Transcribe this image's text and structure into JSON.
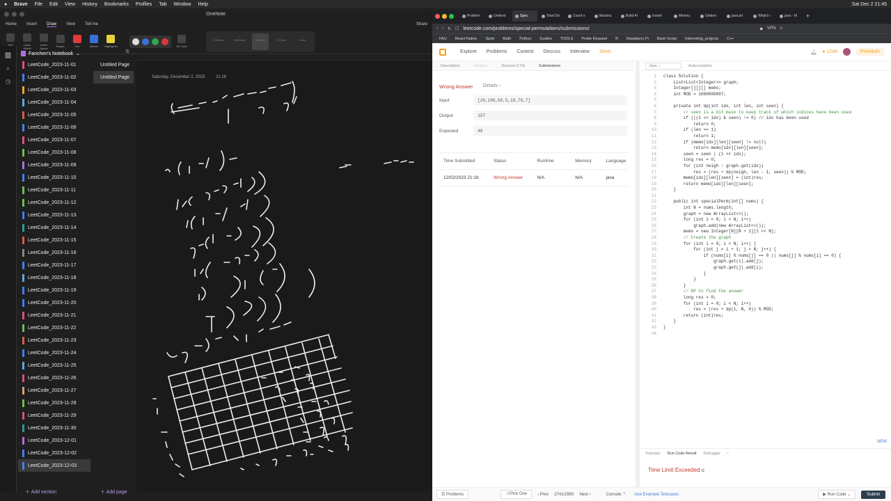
{
  "menubar": {
    "app": "Brave",
    "items": [
      "File",
      "Edit",
      "View",
      "History",
      "Bookmarks",
      "Profiles",
      "Tab",
      "Window",
      "Help"
    ],
    "clock": "Sat Dec 2  21:45"
  },
  "onenote": {
    "title": "OneNote",
    "tabs": [
      "Home",
      "Insert",
      "Draw",
      "View",
      "Tell me"
    ],
    "ribbon": [
      "Text Mode",
      "Lasso Select",
      "Insert Space",
      "Eraser",
      "Pen",
      "Marker",
      "Highlighter",
      "Fill Color"
    ],
    "strokes": [
      "0.35 mm",
      "0.50 mm",
      "0.5 mm",
      "0.7 mm",
      "1 mm"
    ],
    "notebook": "Fanchen's Notebook",
    "sections": [
      {
        "name": "LeetCode_2023-11-01",
        "color": "#e24a8a"
      },
      {
        "name": "LeetCode_2023-11-02",
        "color": "#3b82f6"
      },
      {
        "name": "LeetCode_2023-11-03",
        "color": "#f5a623"
      },
      {
        "name": "LeetCode_2023-11-04",
        "color": "#5aa9e6"
      },
      {
        "name": "LeetCode_2023-11-05",
        "color": "#e05a3a"
      },
      {
        "name": "LeetCode_2023-11-06",
        "color": "#3b82f6"
      },
      {
        "name": "LeetCode_2023-11-07",
        "color": "#e24a8a"
      },
      {
        "name": "LeetCode_2023-11-08",
        "color": "#6cc04a"
      },
      {
        "name": "LeetCode_2023-11-09",
        "color": "#b06fe0"
      },
      {
        "name": "LeetCode_2023-11-10",
        "color": "#3b82f6"
      },
      {
        "name": "LeetCode_2023-11-11",
        "color": "#6cc04a"
      },
      {
        "name": "LeetCode_2023-11-12",
        "color": "#6cc04a"
      },
      {
        "name": "LeetCode_2023-11-13",
        "color": "#3b82f6"
      },
      {
        "name": "LeetCode_2023-11-14",
        "color": "#2a9d8f"
      },
      {
        "name": "LeetCode_2023-11-15",
        "color": "#e05a3a"
      },
      {
        "name": "LeetCode_2023-11-16",
        "color": "#888888"
      },
      {
        "name": "LeetCode_2023-11-17",
        "color": "#3b82f6"
      },
      {
        "name": "LeetCode_2023-11-18",
        "color": "#5aa9e6"
      },
      {
        "name": "LeetCode_2023-11-19",
        "color": "#3b82f6"
      },
      {
        "name": "LeetCode_2023-11-20",
        "color": "#3b82f6"
      },
      {
        "name": "LeetCode_2023-11-21",
        "color": "#e24a8a"
      },
      {
        "name": "LeetCode_2023-11-22",
        "color": "#6cc04a"
      },
      {
        "name": "LeetCode_2023-11-23",
        "color": "#e05a3a"
      },
      {
        "name": "LeetCode_2023-11-24",
        "color": "#3b82f6"
      },
      {
        "name": "LeetCode_2023-11-25",
        "color": "#5aa9e6"
      },
      {
        "name": "LeetCode_2023-11-26",
        "color": "#e24a8a"
      },
      {
        "name": "LeetCode_2023-11-27",
        "color": "#d8a070"
      },
      {
        "name": "LeetCode_2023-11-28",
        "color": "#6cc04a"
      },
      {
        "name": "LeetCode_2023-11-29",
        "color": "#e24a8a"
      },
      {
        "name": "LeetCode_2023-11-30",
        "color": "#2a9d8f"
      },
      {
        "name": "LeetCode_2023-12-01",
        "color": "#b06fe0"
      },
      {
        "name": "LeetCode_2023-12-02",
        "color": "#3b82f6"
      },
      {
        "name": "LeetCode_2023-12-03",
        "color": "#3b82f6"
      }
    ],
    "pages": [
      "Untitled Page",
      "Untitled Page"
    ],
    "date": "Saturday, December 2, 2023",
    "time": "21:16",
    "add_section": "Add section",
    "add_page": "Add page",
    "share": "Share"
  },
  "browser": {
    "tabs": [
      "Problem",
      "Underst",
      "Spec",
      "Total Dis",
      "Count o",
      "Maximu",
      "Build Ar",
      "Inserti",
      "Minimu",
      "Unders",
      "java pri",
      "What's i",
      "java - M"
    ],
    "url": "leetcode.com/problems/special-permutations/submissions/",
    "bookmarks": [
      "FAU",
      "React-Native",
      "Spoti",
      "Math",
      "Python",
      "Guides",
      "TOOLS",
      "Probe Request",
      "R",
      "Raspberry Pi",
      "Bash Script",
      "Interesting_projects",
      "C++"
    ],
    "vpn": "VPN"
  },
  "leetcode": {
    "nav": [
      "Explore",
      "Problems",
      "Contest",
      "Discuss",
      "Interview",
      "Store"
    ],
    "coins": "1248",
    "premium": "Premium",
    "pane_tabs": [
      "Description",
      "Solution",
      "Discuss (174)",
      "Submissions"
    ],
    "result": "Wrong Answer",
    "details": "Details",
    "input_label": "Input",
    "input": "[20,100,50,5,10,70,7]",
    "output_label": "Output",
    "output": "157",
    "expected_label": "Expected",
    "expected": "48",
    "table_headers": [
      "Time Submitted",
      "Status",
      "Runtime",
      "Memory",
      "Language"
    ],
    "table_rows": [
      [
        "12/02/2023 21:16",
        "Wrong Answer",
        "N/A",
        "N/A",
        "java"
      ]
    ],
    "language": "Java",
    "autocomplete": "Autocomplete",
    "code_lines": [
      "class Solution {",
      "    List<List<Integer>> graph;",
      "    Integer[][][] memo;",
      "    int MOD = 1000000007;",
      "",
      "    private int dp(int idx, int len, int seen) {",
      "        // seen is a bit mask to keep track of which indices have been used",
      "        if (((1 << idx) & seen) != 0) // idx has been used",
      "            return 0;",
      "        if (len == 1)",
      "            return 1;",
      "        if (memo[idx][len][seen] != null)",
      "            return memo[idx][len][seen];",
      "        seen = seen | (1 << idx);",
      "        long res = 0;",
      "        for (int neigh : graph.get(idx))",
      "            res = (res + dp(neigh, len - 1, seen)) % MOD;",
      "        memo[idx][len][seen] = (int)res;",
      "        return memo[idx][len][seen];",
      "    }",
      "",
      "    public int specialPerm(int[] nums) {",
      "        int N = nums.length;",
      "        graph = new ArrayList<>();",
      "        for (int i = 0; i < N; i++)",
      "            graph.add(new ArrayList<>());",
      "        memo = new Integer[N][N + 1][1 << N];",
      "        // Create the graph",
      "        for (int i = 0; i < N; i++) {",
      "            for (int j = i + 1; j < N; j++) {",
      "                if (nums[i] % nums[j] == 0 || nums[j] % nums[i] == 0) {",
      "                    graph.get(i).add(j);",
      "                    graph.get(j).add(i);",
      "                }",
      "            }",
      "        }",
      "        // DP to find the answer",
      "        long res = 0;",
      "        for (int i = 0; i < N; i++)",
      "            res = (res + dp(i, N, 0)) % MOD;",
      "        return (int)res;",
      "    }",
      "}",
      ""
    ],
    "new_label": "NEW",
    "bottom_tabs": [
      "Testcase",
      "Run Code Result",
      "Debugger"
    ],
    "run_result": "Time Limit Exceeded",
    "footer": {
      "problems": "Problems",
      "pick_one": "Pick One",
      "prev": "Prev",
      "page": "2741/2950",
      "next": "Next",
      "console": "Console",
      "use_example": "Use Example Testcases",
      "run_code": "Run Code",
      "submit": "Submit"
    }
  }
}
